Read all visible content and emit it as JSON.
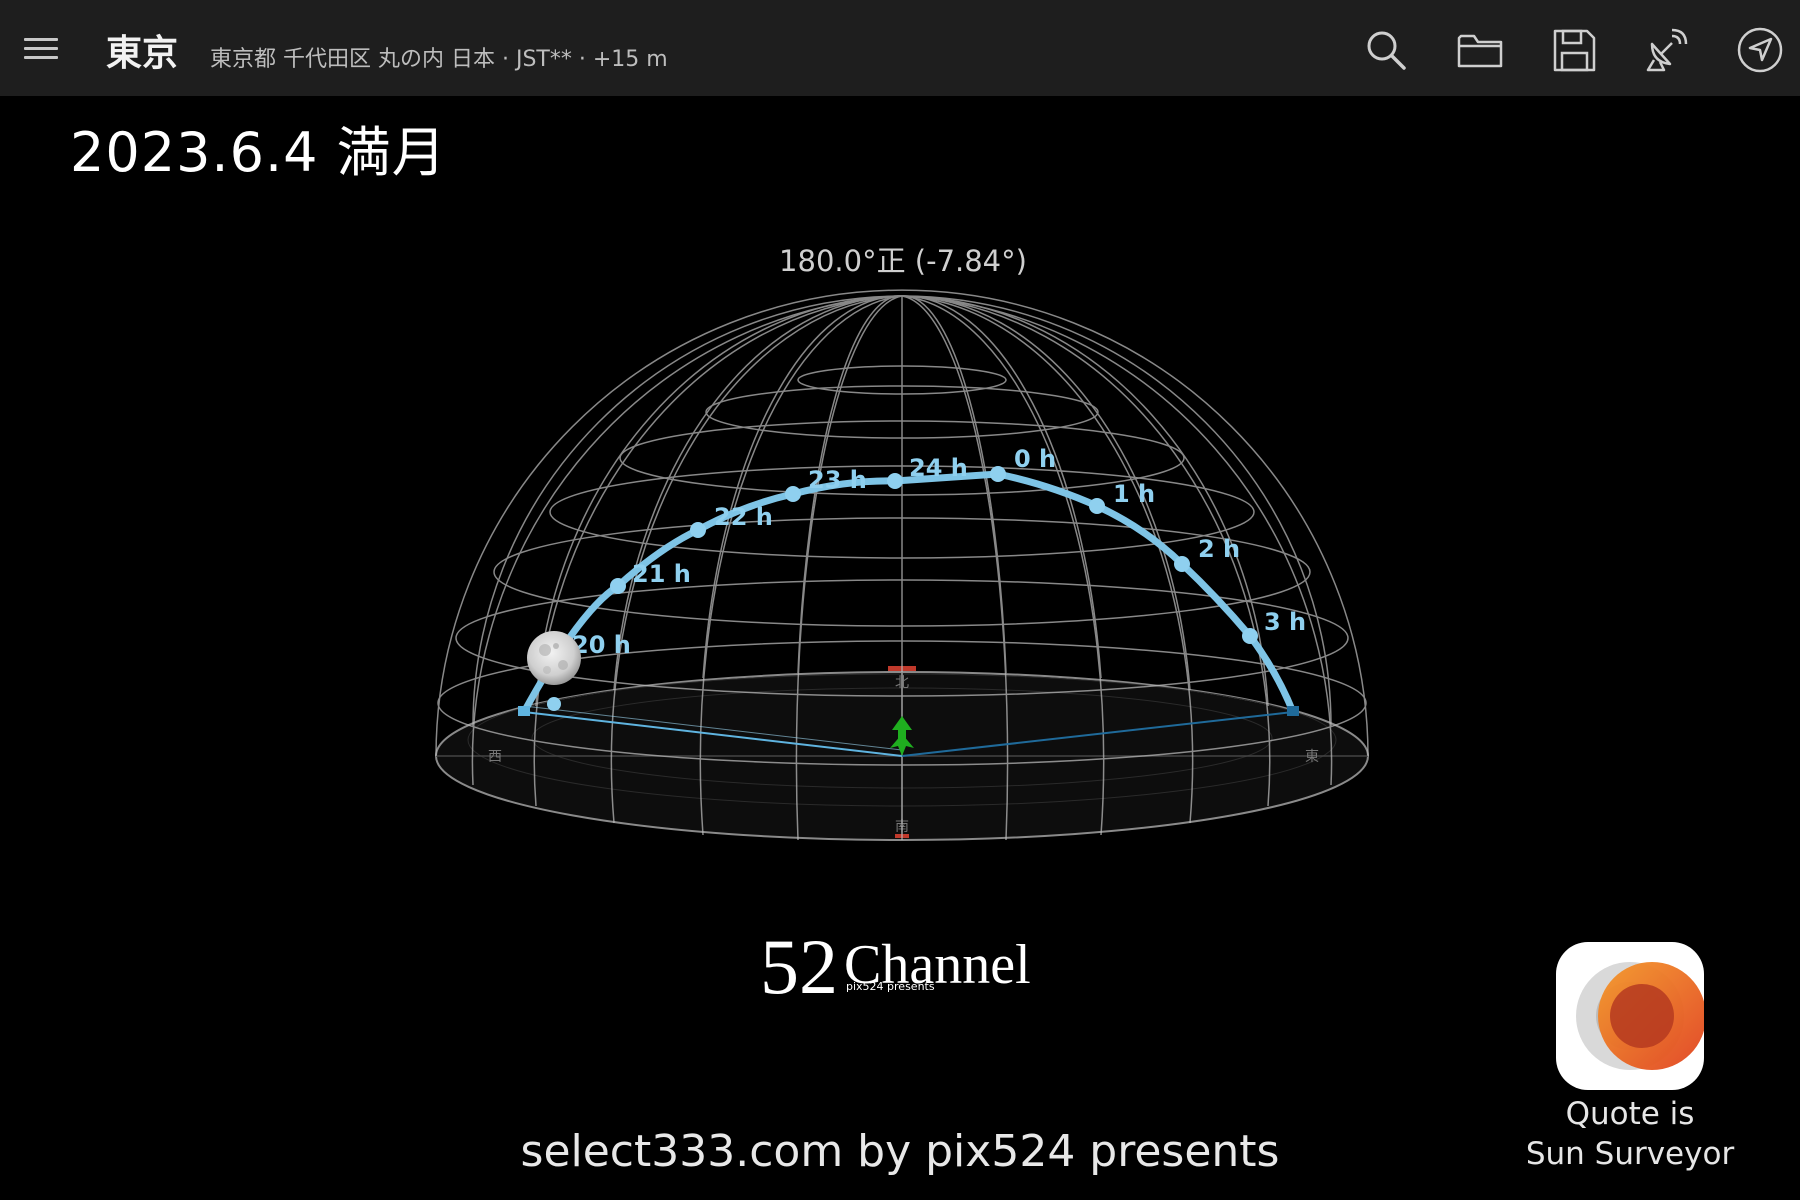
{
  "header": {
    "city": "東京",
    "location": "東京都 千代田区 丸の内 日本 · JST** · +15 m"
  },
  "title": "2023.6.4 満月",
  "view": {
    "heading_readout": "180.0°正 (-7.84°)"
  },
  "moon_path": {
    "hour_labels": [
      "20 h",
      "21 h",
      "22 h",
      "23 h",
      "24 h",
      "0 h",
      "1 h",
      "2 h",
      "3 h"
    ]
  },
  "compass": {
    "north_label": "北",
    "south_label": "南",
    "east_label": "東",
    "west_label": "西"
  },
  "logo": {
    "number": "52",
    "name": "Channel",
    "tagline": "pix524 presents"
  },
  "footer": {
    "text": "select333.com by pix524 presents"
  },
  "badge": {
    "line1": "Quote is",
    "line2": "Sun Surveyor"
  },
  "colors": {
    "path": "#7ec4e6",
    "grid": "#bdbdbd",
    "topbar": "#1e1e1e",
    "arrow": "#1fae1f",
    "marker": "#c0392b"
  },
  "icons": [
    "menu-icon",
    "search-icon",
    "folder-icon",
    "save-icon",
    "satellite-dish-icon",
    "navigation-icon"
  ]
}
